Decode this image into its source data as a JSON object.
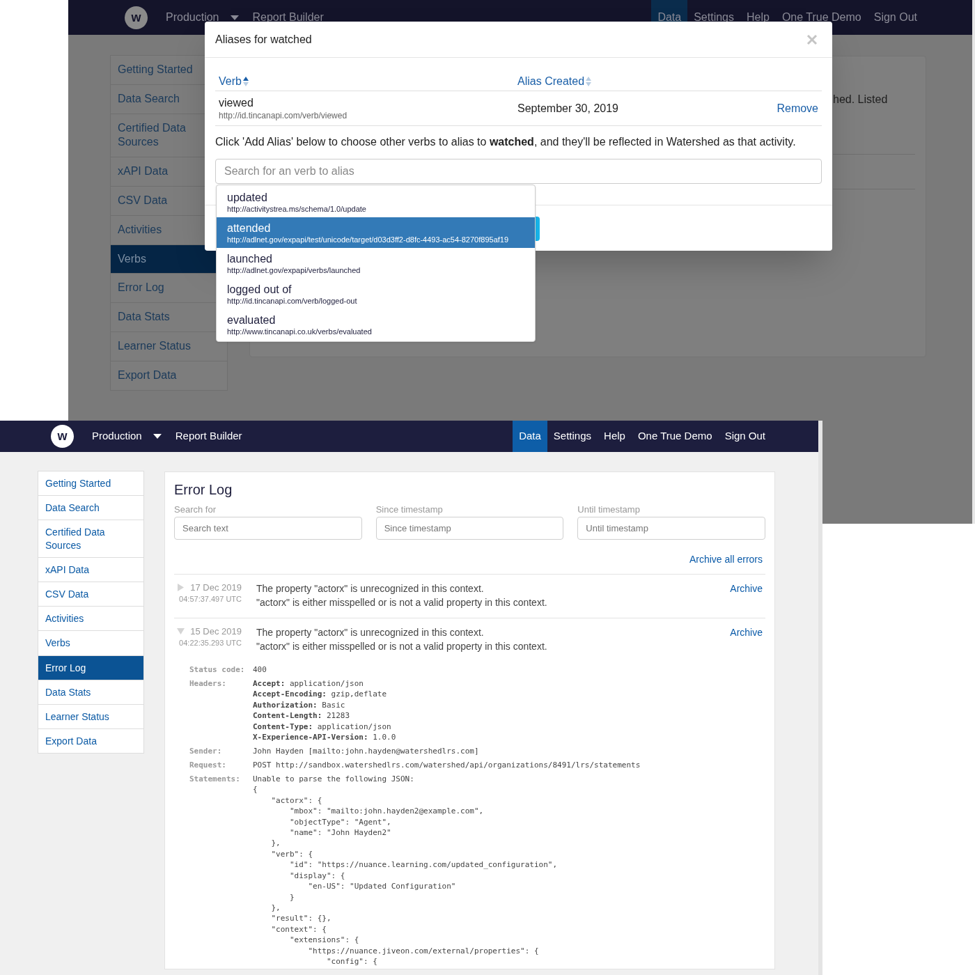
{
  "top_screen": {
    "navbar": {
      "logo": "w",
      "items": [
        {
          "label": "Production",
          "kind": "dropdown"
        },
        {
          "label": "Report Builder",
          "kind": "link"
        }
      ],
      "right": [
        {
          "label": "Data",
          "selected": true
        },
        {
          "label": "Settings",
          "selected": false
        },
        {
          "label": "Help",
          "selected": false
        },
        {
          "label": "One True Demo",
          "selected": false
        },
        {
          "label": "Sign Out",
          "selected": false
        }
      ]
    },
    "sidebar": [
      {
        "label": "Getting Started",
        "selected": false
      },
      {
        "label": "Data Search",
        "selected": false
      },
      {
        "label": "Certified Data Sources",
        "selected": false
      },
      {
        "label": "xAPI Data",
        "selected": false
      },
      {
        "label": "CSV Data",
        "selected": false
      },
      {
        "label": "Activities",
        "selected": false
      },
      {
        "label": "Verbs",
        "selected": true
      },
      {
        "label": "Error Log",
        "selected": false
      },
      {
        "label": "Data Stats",
        "selected": false
      },
      {
        "label": "Learner Status",
        "selected": false
      },
      {
        "label": "Export Data",
        "selected": false
      }
    ],
    "background_text": "hed. Listed",
    "modal": {
      "title": "Aliases for watched",
      "columns": [
        {
          "label": "Verb",
          "sorted": true
        },
        {
          "label": "Alias Created",
          "sorted": false
        }
      ],
      "rows": [
        {
          "verb": "viewed",
          "url": "http://id.tincanapi.com/verb/viewed",
          "created": "September 30, 2019",
          "action": "Remove"
        }
      ],
      "help_text": "Click 'Add Alias' below to choose other verbs to alias to **watched**, and they'll be reflected in Watershed as that activity.",
      "search": {
        "placeholder": "Search for an verb to alias"
      },
      "suggestions": [
        {
          "verb": "updated",
          "url": "http://activitystrea.ms/schema/1.0/update",
          "selected": false
        },
        {
          "verb": "attended",
          "url": "http://adlnet.gov/expapi/test/unicode/target/d03d3ff2-d8fc-4493-ac54-8270f895af19",
          "selected": true
        },
        {
          "verb": "launched",
          "url": "http://adlnet.gov/expapi/verbs/launched",
          "selected": false
        },
        {
          "verb": "logged out of",
          "url": "http://id.tincanapi.com/verb/logged-out",
          "selected": false
        },
        {
          "verb": "evaluated",
          "url": "http://www.tincanapi.co.uk/verbs/evaluated",
          "selected": false
        }
      ]
    }
  },
  "bottom_screen": {
    "navbar": {
      "logo": "w",
      "items": [
        {
          "label": "Production",
          "kind": "dropdown"
        },
        {
          "label": "Report Builder",
          "kind": "link"
        }
      ],
      "right": [
        {
          "label": "Data",
          "selected": true
        },
        {
          "label": "Settings",
          "selected": false
        },
        {
          "label": "Help",
          "selected": false
        },
        {
          "label": "One True Demo",
          "selected": false
        },
        {
          "label": "Sign Out",
          "selected": false
        }
      ]
    },
    "sidebar": [
      {
        "label": "Getting Started",
        "selected": false
      },
      {
        "label": "Data Search",
        "selected": false
      },
      {
        "label": "Certified Data Sources",
        "selected": false
      },
      {
        "label": "xAPI Data",
        "selected": false
      },
      {
        "label": "CSV Data",
        "selected": false
      },
      {
        "label": "Activities",
        "selected": false
      },
      {
        "label": "Verbs",
        "selected": false
      },
      {
        "label": "Error Log",
        "selected": true
      },
      {
        "label": "Data Stats",
        "selected": false
      },
      {
        "label": "Learner Status",
        "selected": false
      },
      {
        "label": "Export Data",
        "selected": false
      }
    ],
    "error_log": {
      "title": "Error Log",
      "filters": [
        {
          "label": "Search for",
          "placeholder": "Search text"
        },
        {
          "label": "Since timestamp",
          "placeholder": "Since timestamp"
        },
        {
          "label": "Until timestamp",
          "placeholder": "Until timestamp"
        }
      ],
      "archive_all": "Archive all errors",
      "errors": [
        {
          "date": "17 Dec 2019",
          "time": "04:57:37.497 UTC",
          "message": "The property \"actorx\" is unrecognized in this context.",
          "detail": "\"actorx\" is either misspelled or is not a valid property in this context.",
          "action": "Archive",
          "expanded": false
        },
        {
          "date": "15 Dec 2019",
          "time": "04:22:35.293 UTC",
          "message": "The property \"actorx\" is unrecognized in this context.",
          "detail": "\"actorx\" is either misspelled or is not a valid property in this context.",
          "action": "Archive",
          "expanded": true
        }
      ],
      "details": [
        {
          "label": "Status code:",
          "lines": [
            "400"
          ]
        },
        {
          "label": "Headers:",
          "lines": [
            "**Accept:** application/json",
            "**Accept-Encoding:** gzip,deflate",
            "**Authorization:** Basic",
            "**Content-Length:** 21283",
            "**Content-Type:** application/json",
            "**X-Experience-API-Version:** 1.0.0"
          ]
        },
        {
          "label": "Sender:",
          "lines": [
            "John Hayden [mailto:john.hayden@watershedlrs.com]"
          ]
        },
        {
          "label": "Request:",
          "lines": [
            "POST http://sandbox.watershedlrs.com/watershed/api/organizations/8491/lrs/statements"
          ]
        },
        {
          "label": "Statements:",
          "lines": [
            "Unable to parse the following JSON:",
            "{",
            "    \"actorx\": {",
            "        \"mbox\": \"mailto:john.hayden2@example.com\",",
            "        \"objectType\": \"Agent\",",
            "        \"name\": \"John Hayden2\"",
            "    },",
            "    \"verb\": {",
            "        \"id\": \"https://nuance.learning.com/updated_configuration\",",
            "        \"display\": {",
            "            \"en-US\": \"Updated Configuration\"",
            "        }",
            "    },",
            "    \"result\": {},",
            "    \"context\": {",
            "        \"extensions\": {",
            "            \"https://nuance.jiveon.com/external/properties\": {",
            "                \"config\": {"
          ]
        }
      ]
    }
  }
}
